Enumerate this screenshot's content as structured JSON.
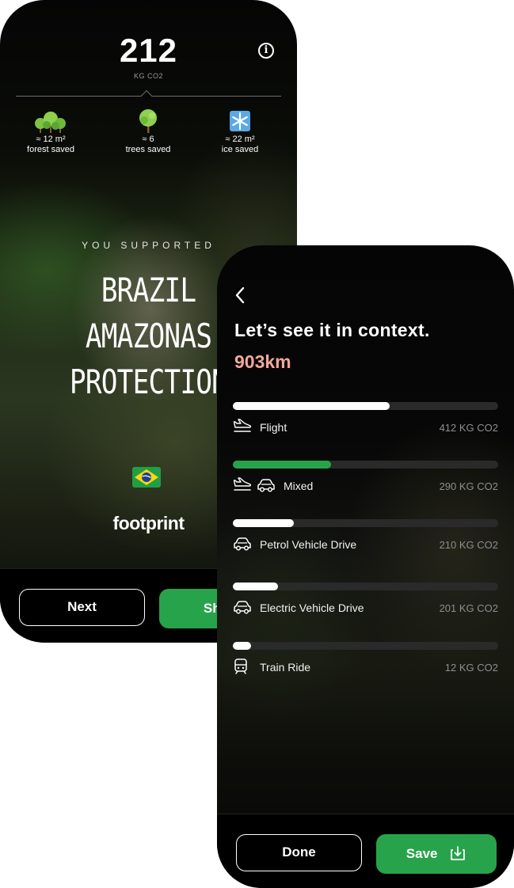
{
  "summary_screen": {
    "total_value": "212",
    "total_unit": "KG CO2",
    "stats": [
      {
        "icon": "forest-icon",
        "value": "≈ 12 m²",
        "label": "forest saved"
      },
      {
        "icon": "tree-icon",
        "value": "≈ 6",
        "label": "trees saved"
      },
      {
        "icon": "snowflake-icon",
        "value": "≈ 22 m²",
        "label": "ice saved"
      }
    ],
    "supported_label": "YOU SUPPORTED",
    "project_title_lines": [
      "BRAZIL",
      "AMAZONAS",
      "PROTECTION"
    ],
    "flag_icon": "brazil-flag-icon",
    "brand_logo_text": "footprint",
    "next_label": "Next",
    "share_label": "Share",
    "accent_green": "#27a34b"
  },
  "context_screen": {
    "heading": "Let’s see it in context.",
    "distance": "903km",
    "distance_color": "#f4a79a",
    "comparisons": [
      {
        "label": "Flight",
        "value": "412 KG CO2",
        "icons": [
          "plane-icon"
        ],
        "fill_fraction": 0.59,
        "bar_color": "#ffffff"
      },
      {
        "label": "Mixed",
        "value": "290 KG CO2",
        "icons": [
          "plane-icon",
          "car-icon"
        ],
        "fill_fraction": 0.37,
        "bar_color": "#27a34b"
      },
      {
        "label": "Petrol Vehicle Drive",
        "value": "210 KG CO2",
        "icons": [
          "car-icon"
        ],
        "fill_fraction": 0.23,
        "bar_color": "#ffffff"
      },
      {
        "label": "Electric Vehicle Drive",
        "value": "201 KG CO2",
        "icons": [
          "car-icon"
        ],
        "fill_fraction": 0.17,
        "bar_color": "#ffffff"
      },
      {
        "label": "Train Ride",
        "value": "12 KG CO2",
        "icons": [
          "train-icon"
        ],
        "fill_fraction": 0.07,
        "bar_color": "#ffffff"
      }
    ],
    "done_label": "Done",
    "save_label": "Save"
  }
}
